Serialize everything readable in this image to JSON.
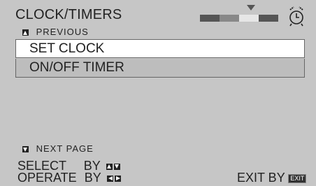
{
  "header": {
    "title": "CLOCK/TIMERS"
  },
  "nav": {
    "previous": "PREVIOUS",
    "next": "NEXT PAGE"
  },
  "menu": {
    "items": [
      {
        "label": "SET CLOCK",
        "selected": true
      },
      {
        "label": "ON/OFF TIMER",
        "selected": false
      }
    ]
  },
  "page_indicator": {
    "segments": 4,
    "current": 3,
    "colors": [
      "#555555",
      "#888888",
      "#e6e6e6",
      "#555555"
    ]
  },
  "footer": {
    "select_label": "SELECT",
    "operate_label": "OPERATE",
    "by": "BY",
    "exit_label": "EXIT BY",
    "exit_key": "EXIT"
  },
  "icons": {
    "alarm": "alarm-clock-icon",
    "up": "up-arrow-key-icon",
    "down": "down-arrow-key-icon",
    "left": "left-arrow-key-icon",
    "right": "right-arrow-key-icon"
  }
}
